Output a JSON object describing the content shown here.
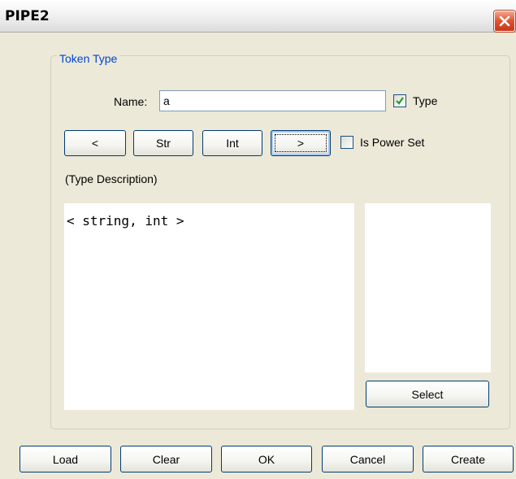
{
  "window": {
    "title": "PIPE2"
  },
  "group": {
    "label": "Token Type"
  },
  "name_field": {
    "label": "Name:",
    "value": "a"
  },
  "type_checkbox": {
    "label": "Type",
    "checked": true
  },
  "type_buttons": {
    "prev_label": "<",
    "str_label": "Str",
    "int_label": "Int",
    "next_label": ">"
  },
  "power_set_checkbox": {
    "label": "Is Power Set",
    "checked": false
  },
  "description": {
    "label": "(Type Description)",
    "value": "< string, int >"
  },
  "side_panel": {
    "select_label": "Select"
  },
  "footer": {
    "load_label": "Load",
    "clear_label": "Clear",
    "ok_label": "OK",
    "cancel_label": "Cancel",
    "create_label": "Create"
  },
  "colors": {
    "accent": "#0046d5",
    "close_button": "#e3512f",
    "window_bg": "#ece9d8",
    "check_mark": "#21a121"
  }
}
